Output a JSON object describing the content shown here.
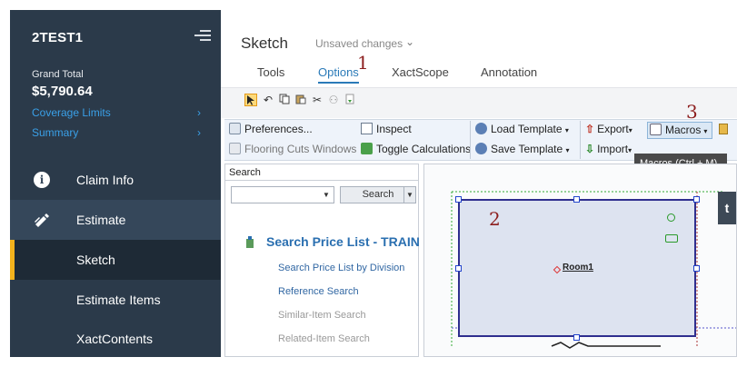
{
  "sidebar": {
    "claim_id": "2TEST1",
    "grand_total_label": "Grand Total",
    "grand_total_value": "$5,790.64",
    "links": [
      {
        "label": "Coverage Limits",
        "chevron": "›"
      },
      {
        "label": "Summary",
        "chevron": "›"
      }
    ],
    "nav": [
      {
        "label": "Claim Info",
        "icon": "info-icon"
      },
      {
        "label": "Estimate",
        "icon": "pencil-icon"
      },
      {
        "label": "Sketch",
        "active": true
      },
      {
        "label": "Estimate Items"
      },
      {
        "label": "XactContents"
      }
    ],
    "colors": {
      "background": "#2b3a4a",
      "link": "#3aa0e8",
      "active_bar": "#f3b21c"
    }
  },
  "header": {
    "title": "Sketch",
    "status": "Unsaved changes",
    "status_chevron": "⌄",
    "tabs": [
      {
        "label": "Tools"
      },
      {
        "label": "Options",
        "active": true
      },
      {
        "label": "XactScope"
      },
      {
        "label": "Annotation"
      }
    ]
  },
  "annotations": {
    "one": "1",
    "two": "2",
    "three": "3"
  },
  "toolbar": {
    "icons": [
      "select-arrow-icon",
      "undo-icon",
      "copy-icon",
      "paste-icon",
      "cut-icon",
      "group-icon",
      "eraser-icon"
    ],
    "ribbon": {
      "preferences": "Preferences...",
      "flooring": "Flooring Cuts Windows",
      "inspect": "Inspect",
      "toggle": "Toggle Calculations",
      "load_template": "Load Template",
      "save_template": "Save Template",
      "export": "Export",
      "import": "Import",
      "macros": "Macros"
    },
    "tooltip": "Macros (Ctrl + M)"
  },
  "search": {
    "label": "Search",
    "button": "Search",
    "heading": "Search Price List - TRAIN",
    "links": [
      {
        "label": "Search Price List by Division",
        "enabled": true
      },
      {
        "label": "Reference Search",
        "enabled": true
      },
      {
        "label": "Similar-Item Search",
        "enabled": false
      },
      {
        "label": "Related-Item Search",
        "enabled": false
      }
    ]
  },
  "canvas": {
    "room_label": "Room1",
    "side_tab": "t"
  }
}
